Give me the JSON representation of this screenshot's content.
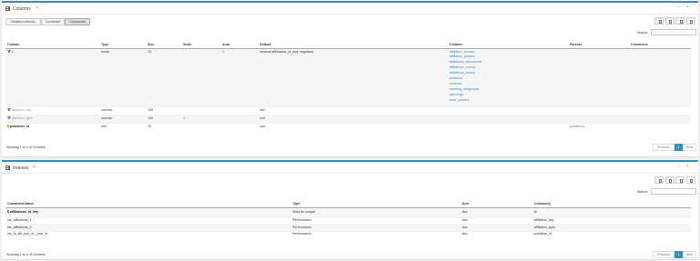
{
  "columns_panel": {
    "title": "Columns",
    "pencil_icon": "pencil-icon",
    "minimize_icon": "minus-icon",
    "close_icon": "close-icon",
    "tabs": [
      "Related columns",
      "Constraint",
      "Comments"
    ],
    "active_tab": "Comments",
    "search_label": "Search:",
    "search_value": "",
    "headers": [
      "Column",
      "Type",
      "Size",
      "Nulls",
      "Auto",
      "Default",
      "Children",
      "Parents",
      "Comments"
    ],
    "rows": [
      {
        "icon": "foreign-key-icon",
        "column": "id",
        "type": "serial",
        "size": "10",
        "nulls": "",
        "auto": "√",
        "default": "nextval('affiliations_id_seq'::regclass)",
        "children": [
          "affiliation_phases",
          "affiliation_phases",
          "affiliations_documents",
          "affiliations_events",
          "affiliations_media",
          "positions",
          "seasons",
          "standing_subgroups",
          "standings",
          "team_phases"
        ],
        "parents": "",
        "comments": ""
      },
      {
        "icon": "foreign-key-icon",
        "column": "affiliation_key",
        "type": "varchar",
        "size": "100",
        "nulls": "",
        "auto": "",
        "default": "null",
        "children": [],
        "parents": "",
        "comments": ""
      },
      {
        "icon": "foreign-key-icon",
        "column": "affiliation_type",
        "type": "varchar",
        "size": "100",
        "nulls": "√",
        "auto": "",
        "default": "null",
        "children": [],
        "parents": "",
        "comments": ""
      },
      {
        "icon": "key-icon",
        "column": "publisher_id",
        "type": "int4",
        "size": "10",
        "nulls": "",
        "auto": "",
        "default": "null",
        "children": [],
        "parents": "publishers",
        "comments": ""
      }
    ],
    "info": "Showing 1 to 4 of 4 entries",
    "pagination": {
      "previous": "Previous",
      "current": "1",
      "next": "Next"
    }
  },
  "indexes_panel": {
    "title": "Indexes",
    "pencil_icon": "pencil-icon",
    "minimize_icon": "minus-icon",
    "close_icon": "close-icon",
    "search_label": "Search:",
    "search_value": "",
    "headers": [
      "Constraint Name",
      "Type",
      "Sort",
      "Column(s)"
    ],
    "rows": [
      {
        "icon": "primary-key-icon",
        "name": "affiliations_id_key",
        "type": "Must be unique",
        "sort": "Asc",
        "columns": "id"
      },
      {
        "icon": "",
        "name": "idx_affiliations_1",
        "type": "Performance",
        "sort": "Asc",
        "columns": "affiliation_key"
      },
      {
        "icon": "",
        "name": "idx_affiliations_2",
        "type": "Performance",
        "sort": "Asc",
        "columns": "affiliation_type"
      },
      {
        "icon": "",
        "name": "idx_fk_affi_pub_id__pub_id",
        "type": "Performance",
        "sort": "Asc",
        "columns": "publisher_id"
      }
    ],
    "info": "Showing 1 to 4 of 4 entries",
    "pagination": {
      "previous": "Previous",
      "current": "1",
      "next": "Next"
    }
  },
  "colors": {
    "accent": "#3c8dbc",
    "link": "#3c8dbc",
    "key_yellow": "#d8b000"
  }
}
